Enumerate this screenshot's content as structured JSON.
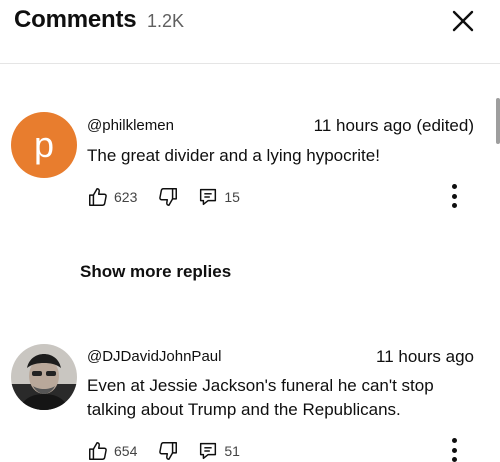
{
  "header": {
    "title": "Comments",
    "count": "1.2K"
  },
  "comments": [
    {
      "avatar_letter": "p",
      "avatar_color": "#e87d2e",
      "author": "@philklemen",
      "time": "11 hours ago (edited)",
      "text": "The great divider and a lying hypocrite!",
      "likes": "623",
      "replies": "15"
    },
    {
      "author": "@DJDavidJohnPaul",
      "time": "11 hours ago",
      "text": "Even at Jessie Jackson's funeral he can't stop talking about Trump and the Republicans.",
      "likes": "654",
      "replies": "51"
    }
  ],
  "show_more_replies": "Show more replies",
  "icons": {
    "close": "close-icon",
    "like": "thumbs-up-icon",
    "dislike": "thumbs-down-icon",
    "reply": "reply-icon",
    "more": "more-vertical-icon"
  }
}
